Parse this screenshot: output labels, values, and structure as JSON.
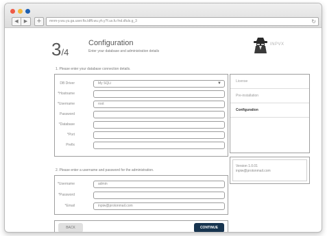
{
  "browser": {
    "url": "mnm-y.wu.yu.ga.user.fts.ldfft.wu.yh.y?f.us.fu  fnd.dfuls.g_3",
    "nav_back": "◀",
    "nav_forward": "▶",
    "add": "+",
    "reload": "↻"
  },
  "header": {
    "step_current": "3",
    "step_total": "/4",
    "title": "Configuration",
    "subtitle": "Enter your database and administration details",
    "logo_text": "INPVX"
  },
  "db_section": {
    "caption": "1. Please enter your database connection details.",
    "fields": [
      {
        "label": "DB Driver",
        "value": "My SQLi"
      },
      {
        "label": "*Hostname",
        "value": ""
      },
      {
        "label": "*Username",
        "value": "root"
      },
      {
        "label": "Password",
        "value": ""
      },
      {
        "label": "*Database",
        "value": ""
      },
      {
        "label": "*Port",
        "value": ""
      },
      {
        "label": "Prefix",
        "value": ""
      }
    ],
    "select_arrow": "▼"
  },
  "admin_section": {
    "caption": "2. Please enter a username and password for the administration.",
    "fields": [
      {
        "label": "*Username",
        "value": "admin"
      },
      {
        "label": "*Password",
        "value": ""
      },
      {
        "label": "*Email",
        "value": "inpiw@protonmail.com"
      }
    ]
  },
  "sidebar": {
    "items": [
      {
        "label": "License"
      },
      {
        "label": "Pre-installation"
      },
      {
        "label": "Configuration"
      }
    ]
  },
  "version_box": {
    "version": "Version 1.0.01",
    "email": "inpiw@protonmail.com"
  },
  "actions": {
    "back_label": "BACK",
    "continue_label": "CONTINUE"
  },
  "colors": {
    "primary_button": "#17344f",
    "close_dot": "#ee5a46",
    "minimize_dot": "#f4b73a",
    "zoom_dot": "#1c5fb1"
  }
}
